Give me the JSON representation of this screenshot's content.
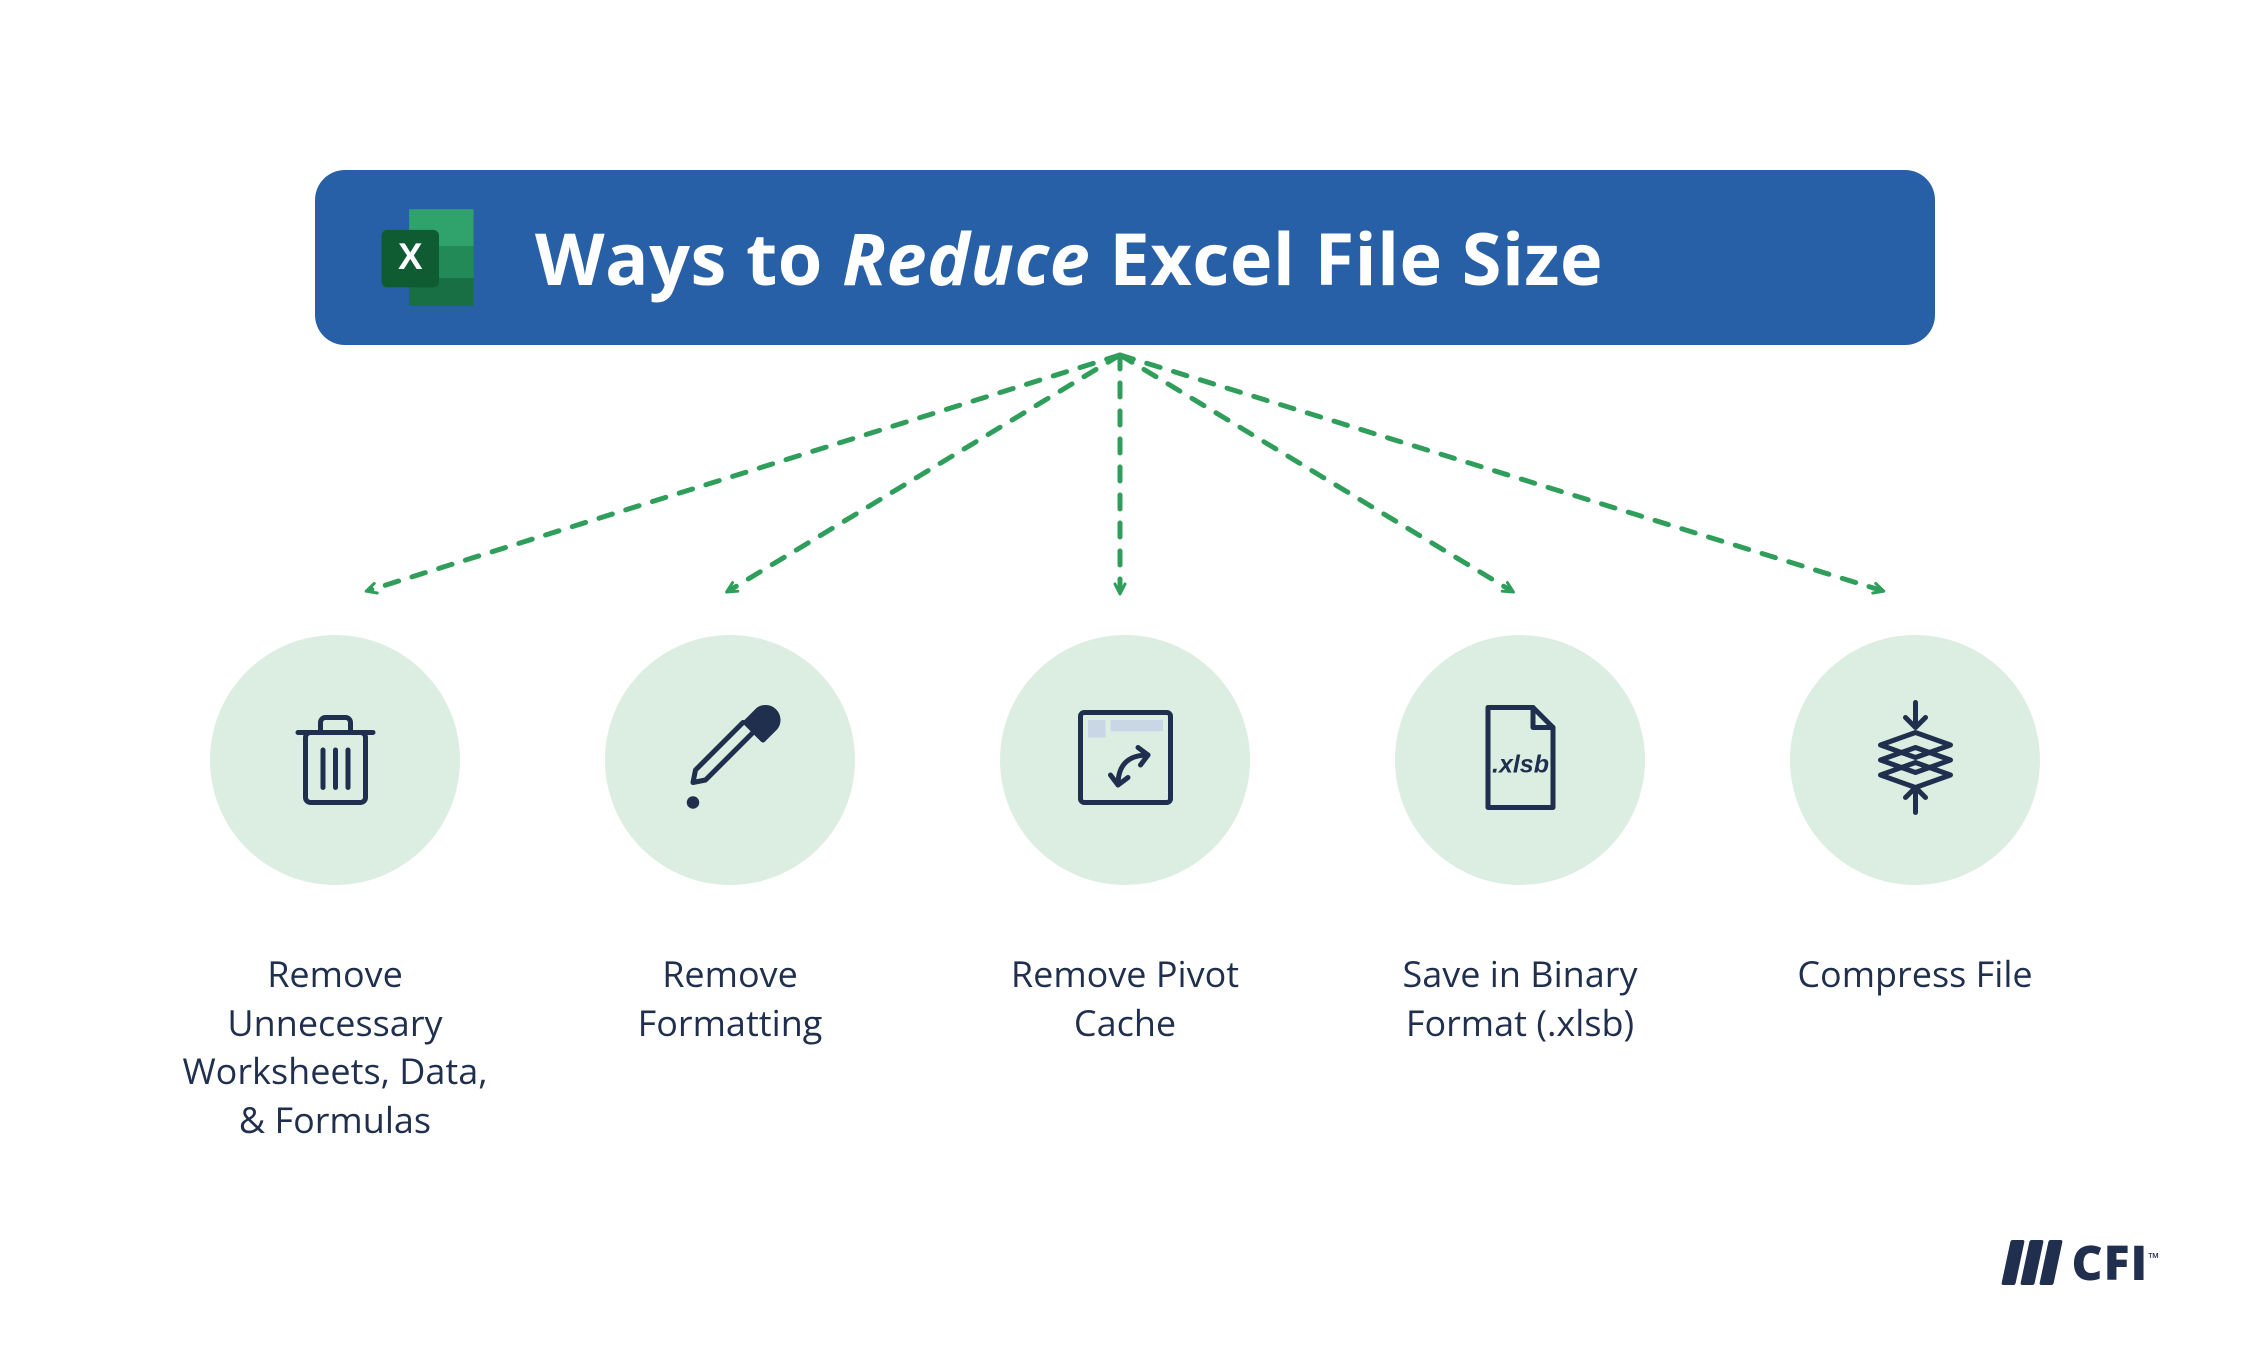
{
  "title": {
    "prefix": "Ways to ",
    "emphasis": "Reduce",
    "suffix": " Excel File Size"
  },
  "items": [
    {
      "label": "Remove Unnecessary Worksheets, Data, & Formulas"
    },
    {
      "label": "Remove Formatting"
    },
    {
      "label": "Remove Pivot Cache"
    },
    {
      "label": "Save in Binary Format (.xlsb)"
    },
    {
      "label": "Compress File"
    }
  ],
  "brand": "CFI",
  "colors": {
    "banner": "#2860a8",
    "circle": "#dceee2",
    "arrow": "#2f9e5a",
    "text": "#1f2f4d",
    "iconStroke": "#1f2f4d"
  },
  "file_label": ".xlsb"
}
